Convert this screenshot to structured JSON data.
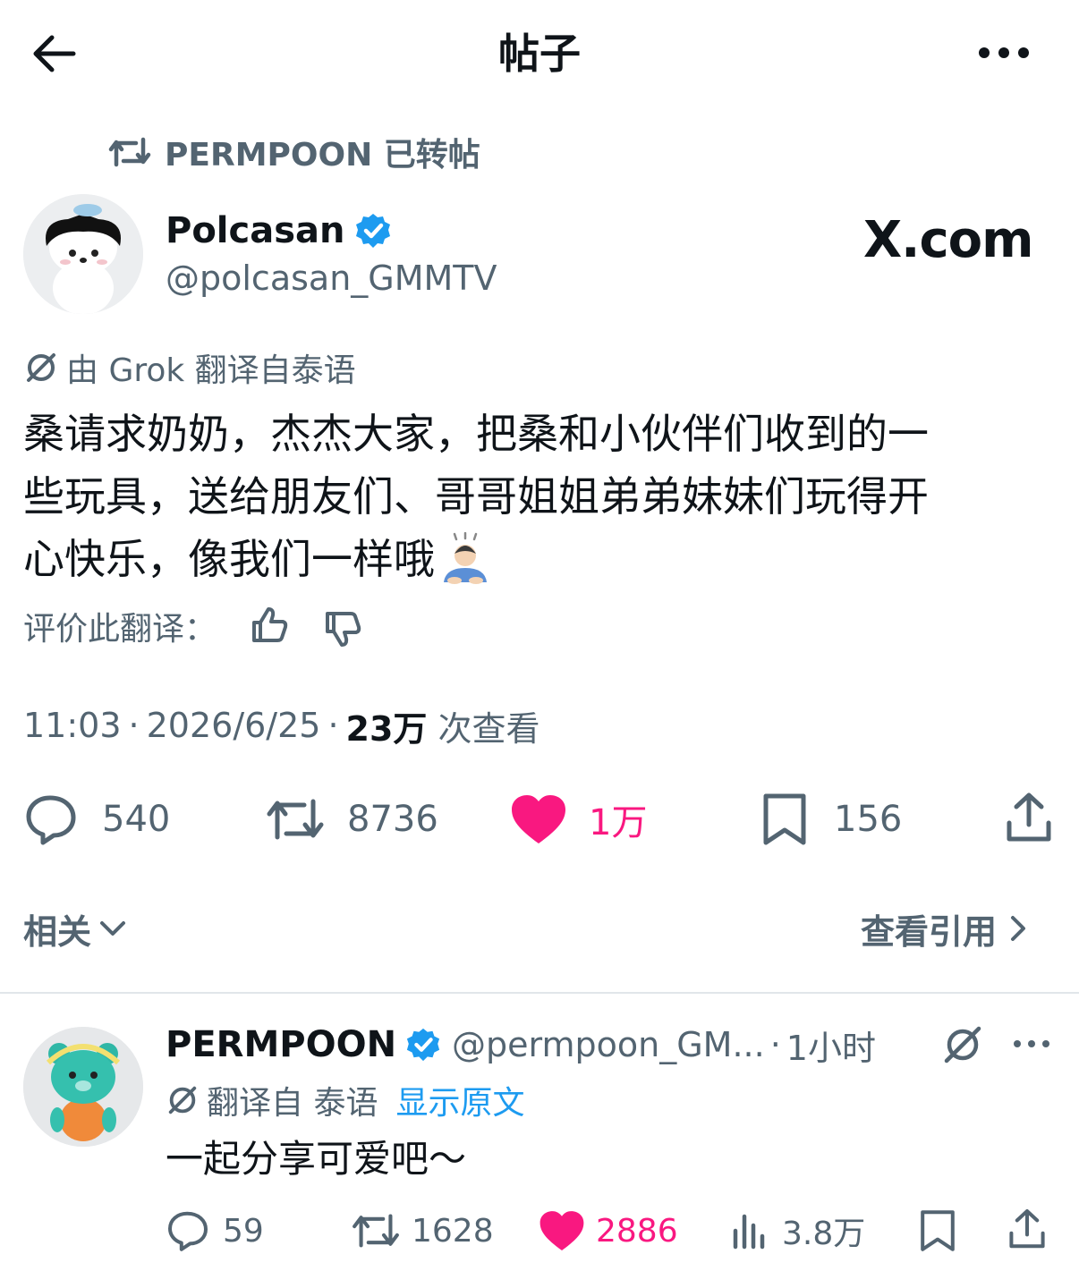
{
  "header": {
    "title": "帖子",
    "back_icon": "back-arrow-icon",
    "more_icon": "more-icon"
  },
  "retweet_banner": {
    "text": "PERMPOON 已转帖"
  },
  "post": {
    "author_name": "Polcasan",
    "author_handle": "@polcasan_GMMTV",
    "watermark": "X.com",
    "translated_notice": "由 Grok 翻译自泰语",
    "body_line1": "桑请求奶奶，杰杰大家，把桑和小伙伴们收到的一",
    "body_line2": "些玩具，送给朋友们、哥哥姐姐弟弟妹妹们玩得开",
    "body_line3": "心快乐，像我们一样哦",
    "rate_label": "评价此翻译：",
    "time": "11:03",
    "date": "2026/6/25",
    "views_count": "23万",
    "views_label": "次查看",
    "replies": "540",
    "reposts": "8736",
    "likes": "1万",
    "bookmarks": "156"
  },
  "related": {
    "label": "相关",
    "view_quotes": "查看引用"
  },
  "reply": {
    "author_name": "PERMPOON",
    "author_handle": "@permpoon_GM...",
    "time": "1小时",
    "translated_prefix": "翻译自 泰语",
    "show_original": "显示原文",
    "text": "一起分享可爱吧～",
    "replies": "59",
    "reposts": "1628",
    "likes": "2886",
    "views": "3.8万"
  },
  "colors": {
    "like_pink": "#f91880",
    "verified_blue": "#1d9bf0",
    "secondary_grey": "#536471"
  }
}
